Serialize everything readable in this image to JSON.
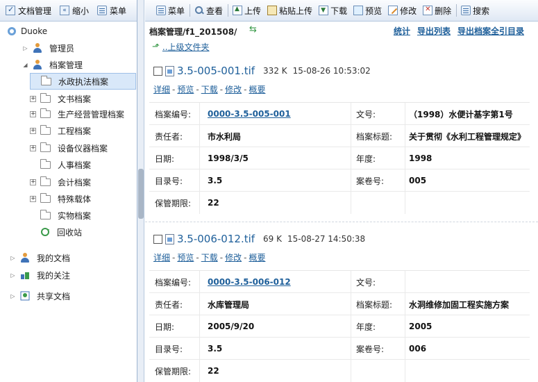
{
  "left_toolbar": {
    "doc_mgmt": "文档管理",
    "shrink": "缩小",
    "menu": "菜单"
  },
  "tree": {
    "root": "Duoke",
    "admin": "管理员",
    "archive_mgmt": "档案管理",
    "items": [
      "水政执法档案",
      "文书档案",
      "生产经营管理档案",
      "工程档案",
      "设备仪器档案",
      "人事档案",
      "会计档案",
      "特殊载体",
      "实物档案",
      "回收站"
    ],
    "my_docs": "我的文档",
    "my_follow": "我的关注",
    "shared_docs": "共享文档"
  },
  "toolbar": {
    "menu": "菜单",
    "view": "查看",
    "upload": "上传",
    "paste_upload": "粘贴上传",
    "download": "下载",
    "preview": "预览",
    "edit": "修改",
    "delete": "删除",
    "search": "搜索"
  },
  "content": {
    "path": "档案管理/f1_201508/",
    "links": {
      "stats": "统计",
      "export_list": "导出列表",
      "export_index": "导出档案全引目录"
    },
    "parent_folder": "..上级文件夹",
    "actions": [
      "详细",
      "预览",
      "下载",
      "修改",
      "概要"
    ],
    "labels": {
      "archive_no": "档案编号:",
      "doc_no": "文号:",
      "responsible": "责任者:",
      "title": "档案标题:",
      "date": "日期:",
      "year": "年度:",
      "catalog_no": "目录号:",
      "volume_no": "案卷号:",
      "retention": "保管期限:"
    },
    "records": [
      {
        "filename": "3.5-005-001.tif",
        "size": "332 K",
        "datetime": "15-08-26 10:53:02",
        "archive_no": "0000-3.5-005-001",
        "doc_no": "（1998）水便计基字第1号",
        "responsible": "市水利局",
        "title": "关于贯彻《水利工程管理规定》",
        "date": "1998/3/5",
        "year": "1998",
        "catalog_no": "3.5",
        "volume_no": "005",
        "retention": "22"
      },
      {
        "filename": "3.5-006-012.tif",
        "size": "69 K",
        "datetime": "15-08-27 14:50:38",
        "archive_no": "0000-3.5-006-012",
        "doc_no": "",
        "responsible": "水库管理局",
        "title": "水洞维修加固工程实施方案",
        "date": "2005/9/20",
        "year": "2005",
        "catalog_no": "3.5",
        "volume_no": "006",
        "retention": "22"
      }
    ]
  }
}
